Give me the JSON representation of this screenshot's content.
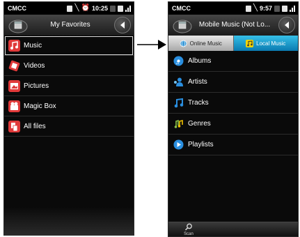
{
  "left_screen": {
    "status": {
      "carrier": "CMCC",
      "time": "10:25"
    },
    "title": "My Favorites",
    "items": [
      {
        "label": "Music",
        "icon": "music-note-icon",
        "color": "#e03a3a"
      },
      {
        "label": "Videos",
        "icon": "video-icon",
        "color": "#e03a3a"
      },
      {
        "label": "Pictures",
        "icon": "picture-icon",
        "color": "#e03a3a"
      },
      {
        "label": "Magic Box",
        "icon": "magic-box-icon",
        "color": "#e03a3a"
      },
      {
        "label": "All files",
        "icon": "files-icon",
        "color": "#e03a3a"
      }
    ],
    "selected_index": 0
  },
  "right_screen": {
    "status": {
      "carrier": "CMCC",
      "time": "9:57"
    },
    "title": "Mobile Music (Not Lo...",
    "tabs": [
      {
        "label": "Online Music",
        "icon": "globe-icon",
        "active": false
      },
      {
        "label": "Local Music",
        "icon": "music-note-icon",
        "active": true
      }
    ],
    "items": [
      {
        "label": "Albums",
        "icon": "album-icon"
      },
      {
        "label": "Artists",
        "icon": "artist-icon"
      },
      {
        "label": "Tracks",
        "icon": "music-note-icon"
      },
      {
        "label": "Genres",
        "icon": "genre-icon"
      },
      {
        "label": "Playlists",
        "icon": "play-icon"
      }
    ],
    "bottom": {
      "scan_label": "Scan"
    }
  },
  "colors": {
    "active_tab": "#1aa0d8",
    "accent_red": "#e03a3a",
    "accent_blue": "#2a8fe0"
  }
}
